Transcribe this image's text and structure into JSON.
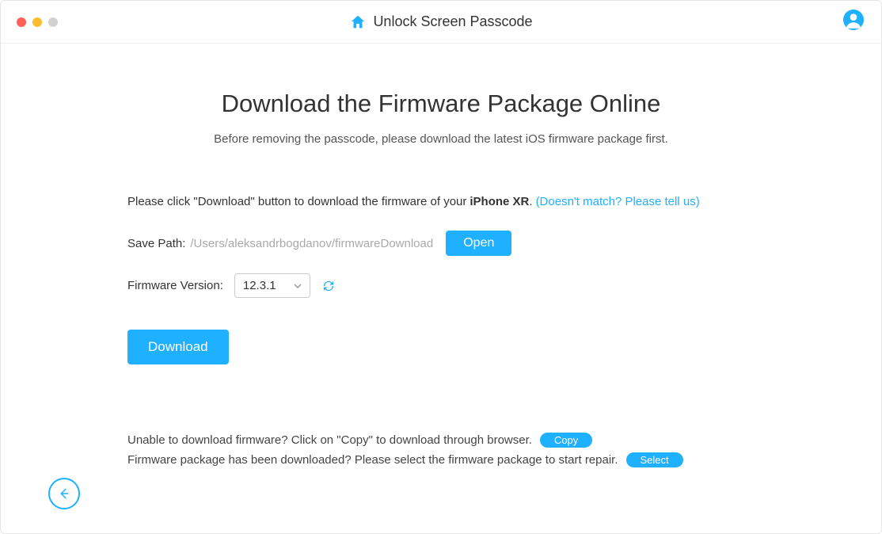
{
  "titlebar": {
    "title": "Unlock Screen Passcode"
  },
  "main": {
    "heading": "Download the Firmware Package Online",
    "subheading": "Before removing the passcode, please download the latest iOS firmware package first.",
    "click_prefix": "Please click \"Download\" button to download the firmware of your ",
    "device_name": "iPhone XR",
    "period": ".",
    "mismatch_link": "(Doesn't match? Please tell us)",
    "save_path_label": "Save Path:",
    "save_path_value": "/Users/aleksandrbogdanov/firmwareDownload",
    "open_button": "Open",
    "firmware_version_label": "Firmware Version:",
    "firmware_version_value": "12.3.1",
    "download_button": "Download"
  },
  "footer": {
    "line1_text": "Unable to download firmware? Click on \"Copy\" to download through browser.",
    "copy_button": "Copy",
    "line2_text": "Firmware package has been downloaded? Please select the firmware package to start repair.",
    "select_button": "Select"
  }
}
